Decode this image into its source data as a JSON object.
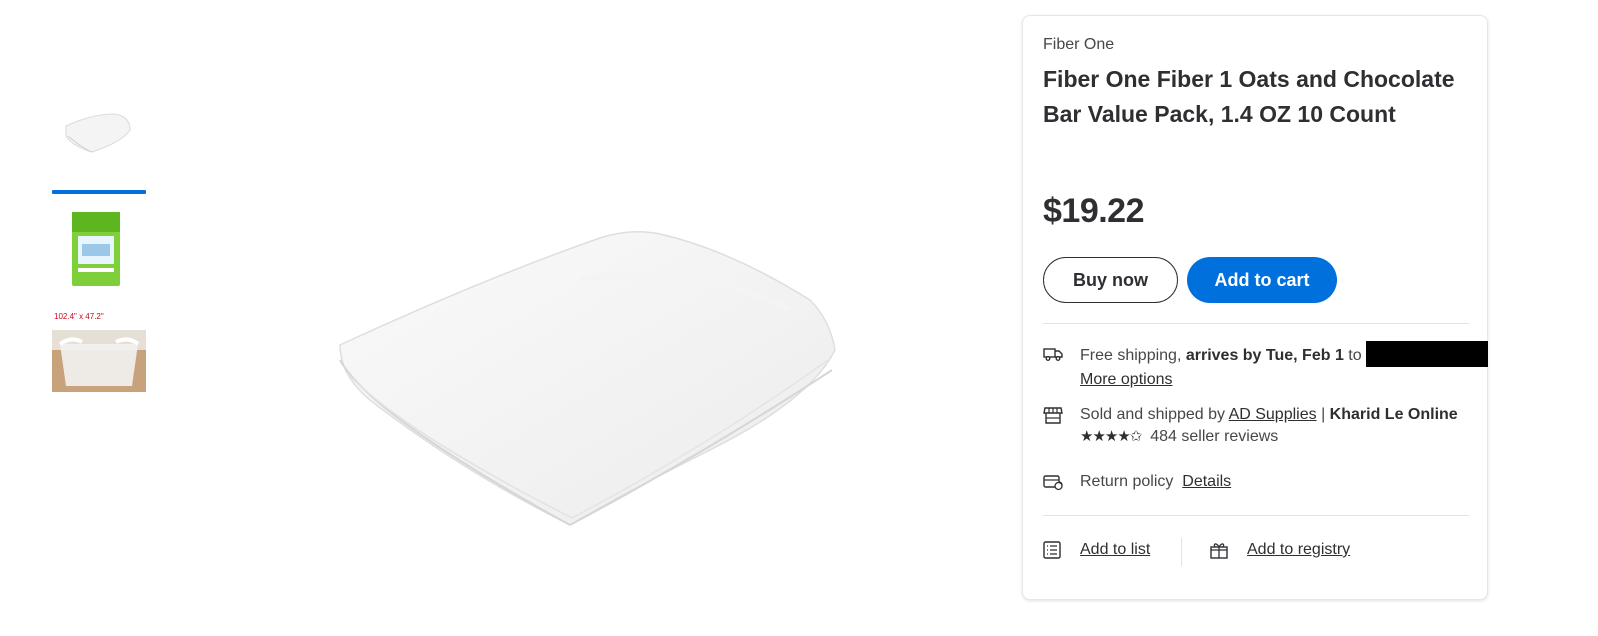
{
  "gallery": {
    "thumbnails": [
      {
        "alt": "folded white sheet",
        "selected": true
      },
      {
        "alt": "green package",
        "selected": false
      },
      {
        "alt": "liner in tub",
        "caption": "102.4\" x 47.2\"",
        "selected": false
      }
    ]
  },
  "product": {
    "brand": "Fiber One",
    "title": "Fiber One Fiber 1 Oats and Chocolate Bar Value Pack, 1.4 OZ 10 Count",
    "price": "$19.22"
  },
  "actions": {
    "buy_now": "Buy now",
    "add_to_cart": "Add to cart"
  },
  "shipping": {
    "prefix": "Free shipping,",
    "arrival": "arrives by Tue, Feb 1",
    "to": "to",
    "more_options": "More options"
  },
  "seller": {
    "prefix": "Sold and shipped by",
    "seller_name": "AD Supplies",
    "separator": "|",
    "store": "Kharid Le Online",
    "rating": 4.5,
    "stars": "★★★★✩",
    "reviews": "484 seller reviews"
  },
  "returns": {
    "label": "Return policy",
    "details": "Details"
  },
  "lists": {
    "add_to_list": "Add to list",
    "add_to_registry": "Add to registry"
  },
  "colors": {
    "accent": "#0071dc",
    "text": "#2e2f32"
  },
  "icons": [
    "truck-icon",
    "store-icon",
    "return-icon",
    "list-icon",
    "gift-icon"
  ]
}
